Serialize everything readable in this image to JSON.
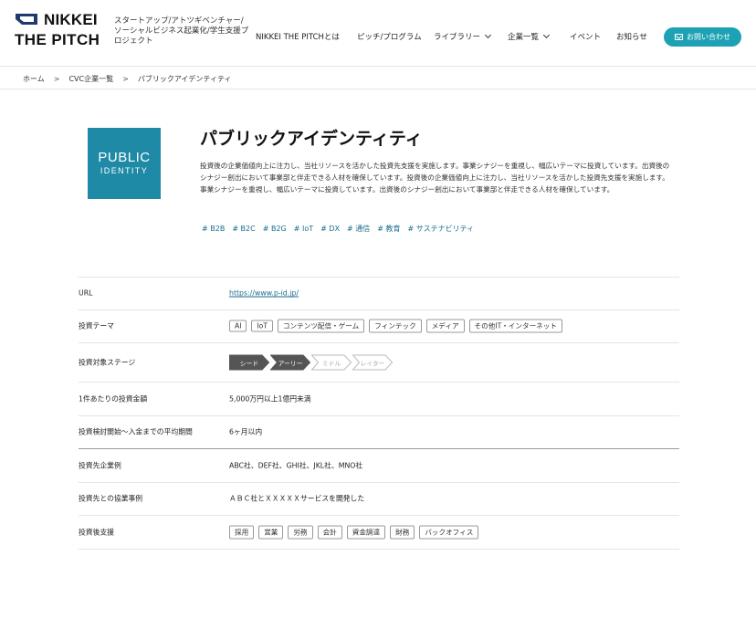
{
  "header": {
    "logo_line1": "NIKKEI",
    "logo_line2": "THE PITCH",
    "tagline": "スタートアップ/アトツギベンチャー/ソーシャルビジネス起業化/学生支援プロジェクト",
    "nav": [
      {
        "label": "NIKKEI THE PITCHとは",
        "has_dropdown": false
      },
      {
        "label": "ピッチ/プログラム",
        "has_dropdown": false
      },
      {
        "label": "ライブラリー",
        "has_dropdown": true
      },
      {
        "label": "企業一覧",
        "has_dropdown": true
      },
      {
        "label": "イベント",
        "has_dropdown": false
      },
      {
        "label": "お知らせ",
        "has_dropdown": false
      }
    ],
    "contact_label": "お問い合わせ",
    "brand_color": "#1da1b5"
  },
  "breadcrumb": {
    "sep": ">",
    "items": [
      "ホーム",
      "CVC企業一覧",
      "パブリックアイデンティティ"
    ]
  },
  "company": {
    "logo_line1": "PUBLIC",
    "logo_line2": "IDENTITY",
    "logo_color": "#1e8aa6",
    "name": "パブリックアイデンティティ",
    "description": "投資後の企業価値向上に注力し、当社リソースを活かした投資先支援を実施します。事業シナジーを重視し、幅広いテーマに投資しています。出資後のシナジー創出において事業部と伴走できる人材を確保しています。投資後の企業価値向上に注力し、当社リソースを活かした投資先支援を実施します。事業シナジーを重視し、幅広いテーマに投資しています。出資後のシナジー創出において事業部と伴走できる人材を確保しています。",
    "tags": [
      "# B2B",
      "# B2C",
      "# B2G",
      "# IoT",
      "# DX",
      "# 通信",
      "# 教育",
      "# サステナビリティ"
    ]
  },
  "info": {
    "url_label": "URL",
    "url": "https://www.p-id.jp/",
    "themes_label": "投資テーマ",
    "themes": [
      "AI",
      "IoT",
      "コンテンツ配信・ゲーム",
      "フィンテック",
      "メディア",
      "その他IT・インターネット"
    ],
    "stage_label": "投資対象ステージ",
    "stages": [
      {
        "label": "シード",
        "active": true
      },
      {
        "label": "アーリー",
        "active": true
      },
      {
        "label": "ミドル",
        "active": false
      },
      {
        "label": "レイター",
        "active": false
      }
    ],
    "amount_label": "1件あたりの投資金額",
    "amount": "5,000万円以上1億円未満",
    "period_label": "投資検討開始〜入金までの平均期間",
    "period": "6ヶ月以内",
    "portfolio_label": "投資先企業例",
    "portfolio": "ABC社、DEF社、GHI社、JKL社、MNO社",
    "collab_label": "投資先との協業事例",
    "collab": "ＡＢＣ社とＸＸＸＸＸサービスを開発した",
    "support_label": "投資後支援",
    "support": [
      "採用",
      "営業",
      "労務",
      "会計",
      "資金調達",
      "財務",
      "バックオフィス"
    ]
  }
}
